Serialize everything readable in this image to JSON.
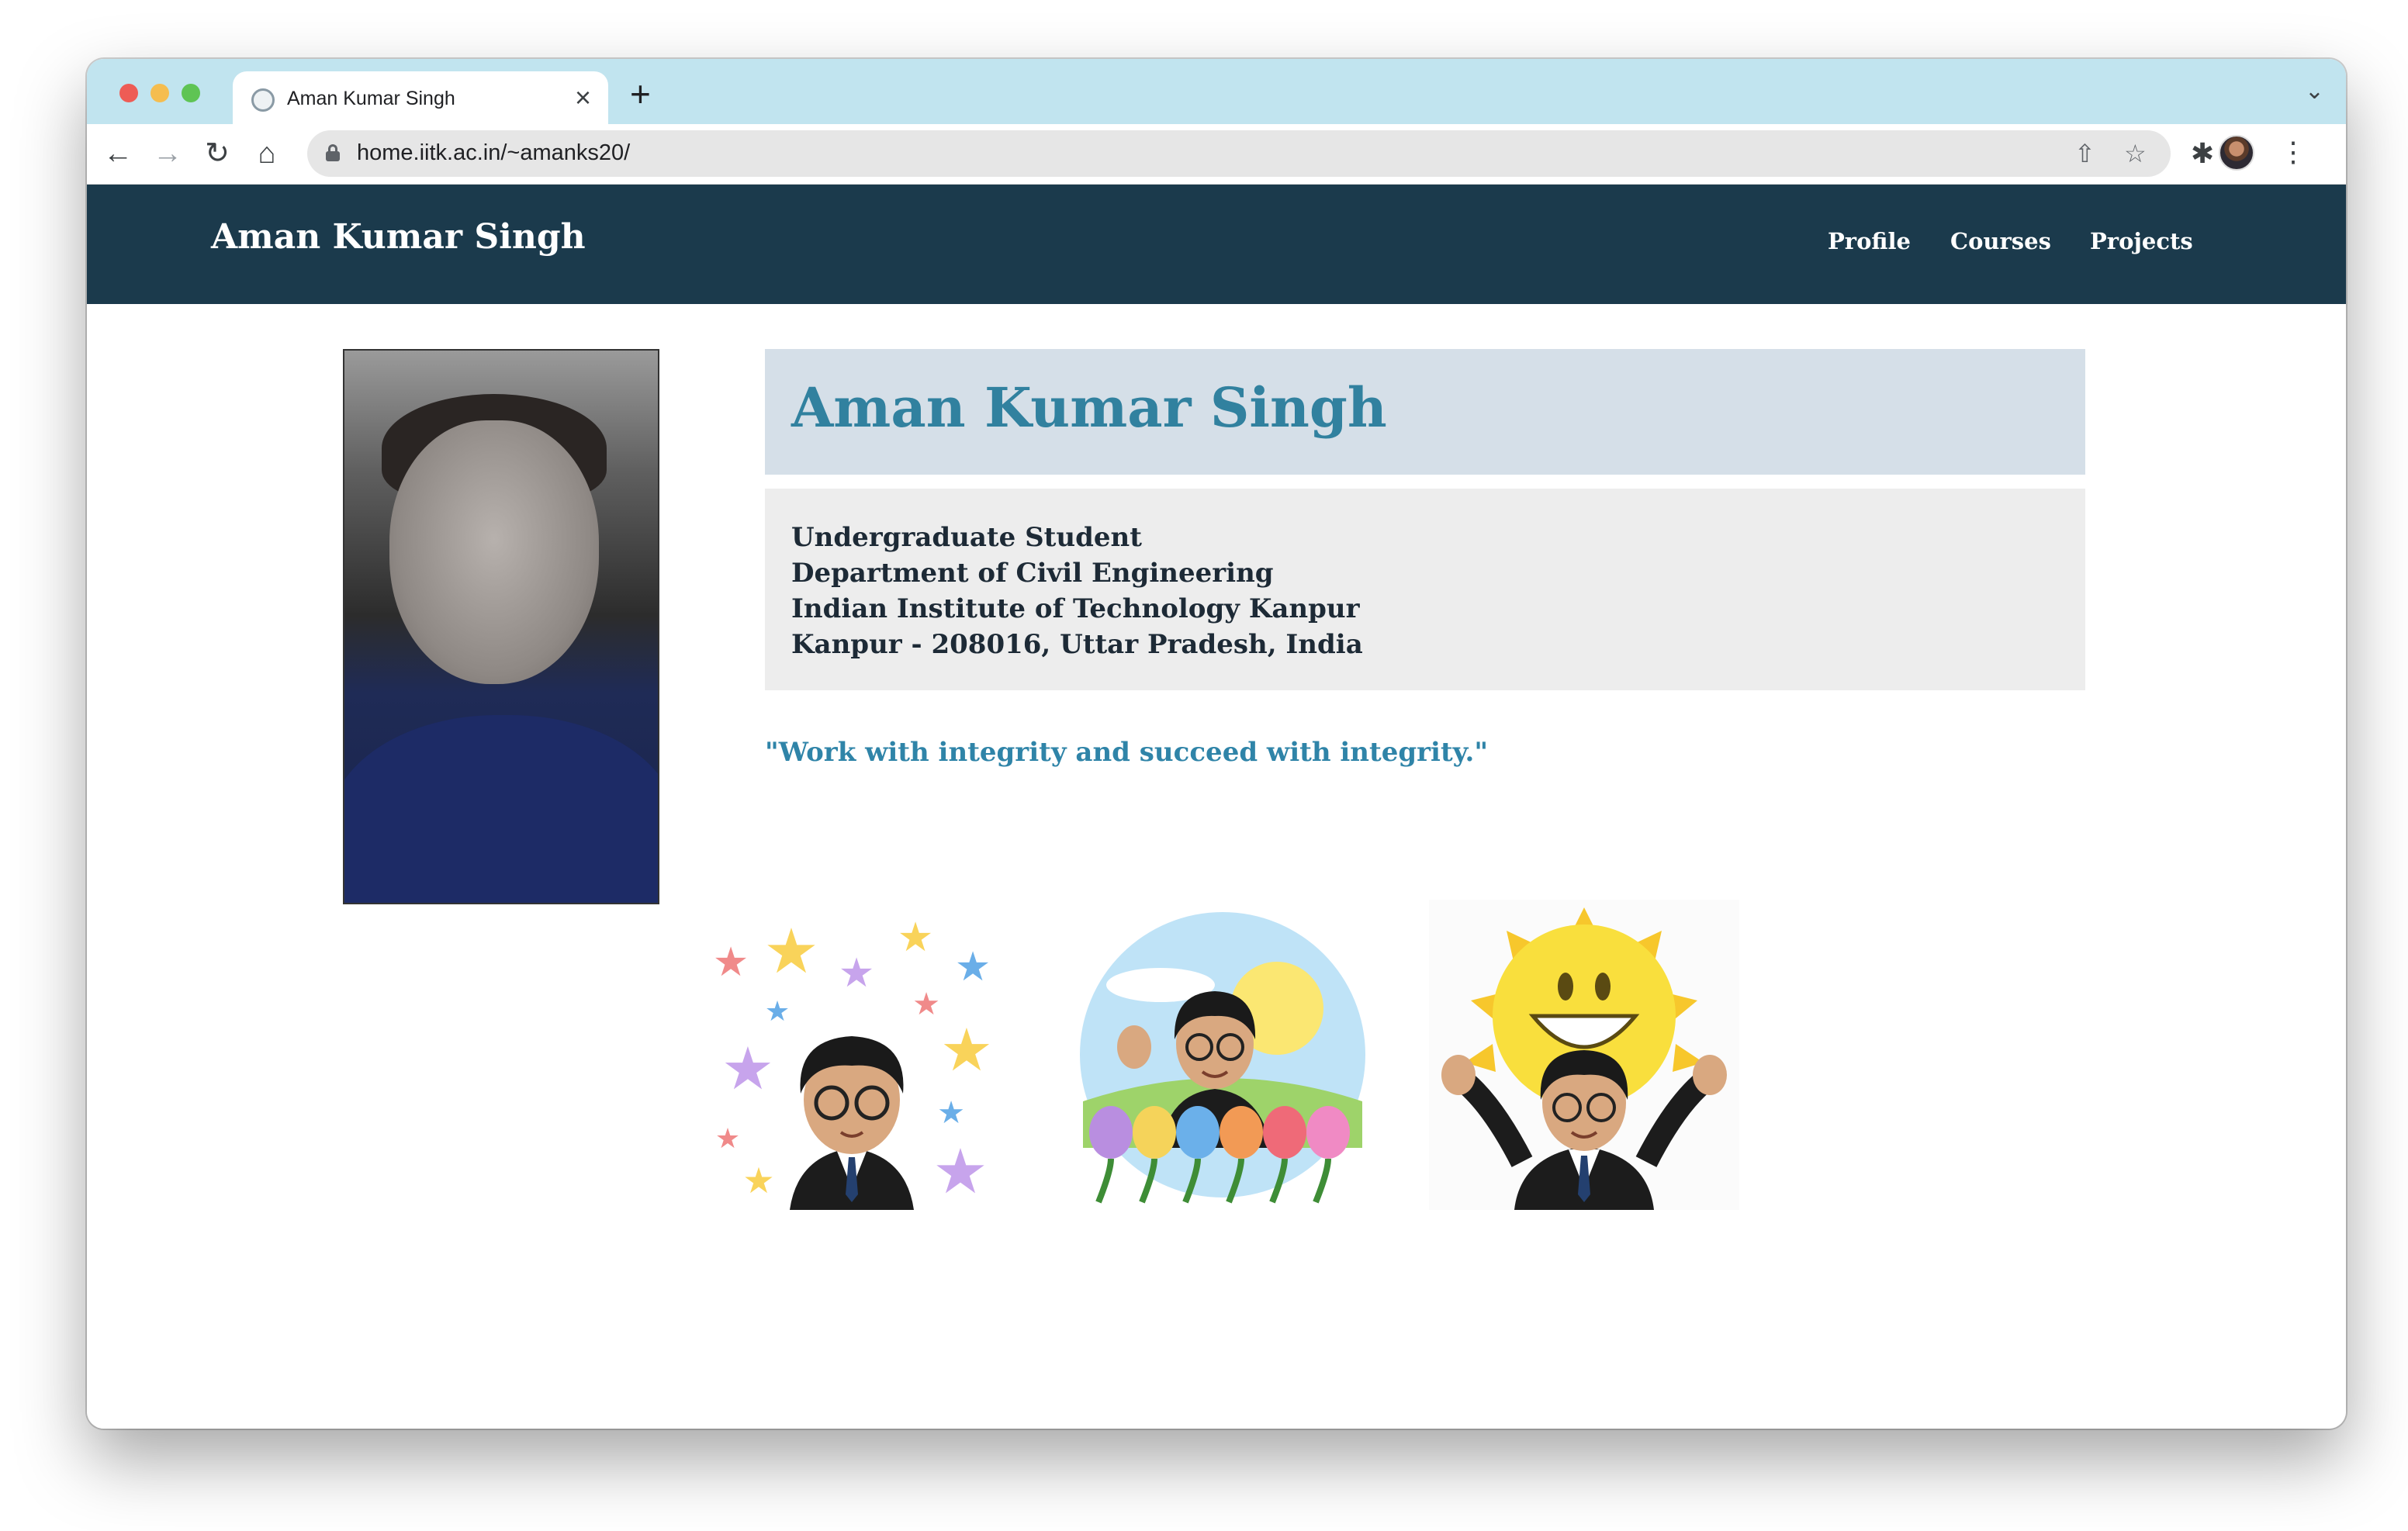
{
  "browser": {
    "tab_title": "Aman Kumar Singh",
    "tab_close_glyph": "×",
    "new_tab_glyph": "+",
    "tab_menu_glyph": "⌄",
    "url": "home.iitk.ac.in/~amanks20/",
    "icons": {
      "back": "←",
      "forward": "→",
      "reload": "↻",
      "home": "⌂",
      "share": "⇧",
      "bookmark": "☆",
      "extensions": "✱",
      "menu": "⋮"
    }
  },
  "site": {
    "brand": "Aman Kumar Singh",
    "nav": [
      "Profile",
      "Courses",
      "Projects"
    ]
  },
  "profile": {
    "name": "Aman Kumar Singh",
    "info": [
      "Undergraduate Student",
      "Department of Civil Engineering",
      "Indian Institute of Technology Kanpur",
      "Kanpur - 208016, Uttar Pradesh, India"
    ],
    "quote": "\"Work with integrity and succeed with integrity.\""
  },
  "colors": {
    "navbar": "#1b3a4c",
    "name_heading": "#31819f",
    "quote": "#2f84a8",
    "name_box": "#d5dfe8",
    "info_box": "#ededed",
    "tabstrip": "#c1e4ef"
  }
}
